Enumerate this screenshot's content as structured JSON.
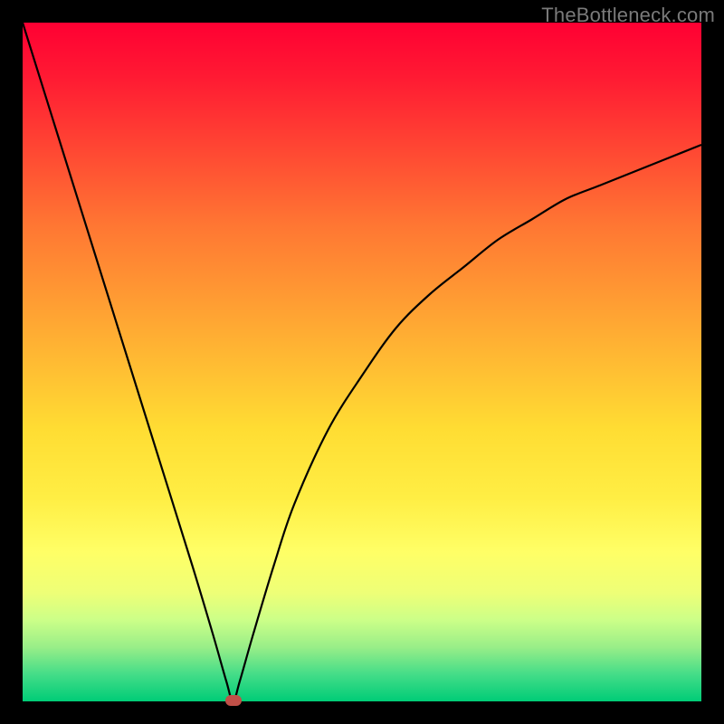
{
  "watermark": "TheBottleneck.com",
  "chart_data": {
    "type": "line",
    "title": "",
    "xlabel": "",
    "ylabel": "",
    "xlim": [
      0,
      100
    ],
    "ylim": [
      0,
      100
    ],
    "gradient_background": {
      "top_color": "#ff0033",
      "bottom_color": "#00cc77",
      "description": "vertical red-to-green gradient representing bottleneck severity (red high, green low)"
    },
    "series": [
      {
        "name": "bottleneck-curve",
        "description": "V-shaped curve with minimum near x≈31; left branch descends steeply from top-left, right branch rises asymptotically toward ~83 at right edge",
        "x": [
          0,
          5,
          10,
          15,
          20,
          25,
          28,
          30,
          31,
          32,
          34,
          37,
          40,
          45,
          50,
          55,
          60,
          65,
          70,
          75,
          80,
          85,
          90,
          95,
          100
        ],
        "values": [
          100,
          84,
          68,
          52,
          36,
          20,
          10,
          3,
          0,
          3,
          10,
          20,
          29,
          40,
          48,
          55,
          60,
          64,
          68,
          71,
          74,
          76,
          78,
          80,
          82
        ]
      }
    ],
    "marker": {
      "name": "optimal-point",
      "x": 31,
      "y": 0,
      "color": "#c05048"
    }
  },
  "layout": {
    "frame_size": 800,
    "plot_inset": 25,
    "plot_size": 750
  }
}
